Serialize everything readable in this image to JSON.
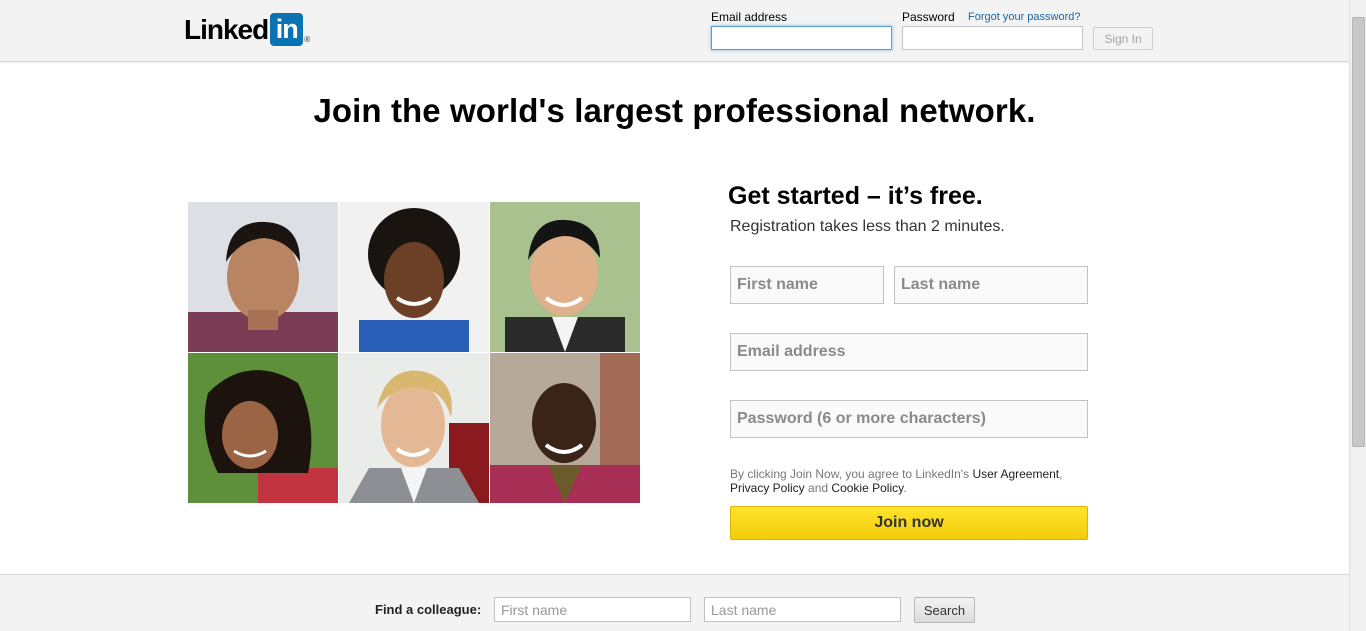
{
  "header": {
    "logo_text": "Linked",
    "logo_in": "in",
    "logo_reg": "®",
    "email_label": "Email address",
    "password_label": "Password",
    "forgot_link": "Forgot your password?",
    "signin_label": "Sign In"
  },
  "main": {
    "headline": "Join the world's largest professional network.",
    "reg_title": "Get started – it’s free.",
    "reg_subtitle": "Registration takes less than 2 minutes.",
    "first_name_placeholder": "First name",
    "last_name_placeholder": "Last name",
    "email_placeholder": "Email address",
    "password_placeholder": "Password (6 or more characters)",
    "terms_prefix": "By clicking Join Now, you agree to LinkedIn's",
    "terms_user_agreement": "User Agreement",
    "terms_comma": ",",
    "terms_privacy": "Privacy Policy",
    "terms_and": "and",
    "terms_cookie": "Cookie Policy",
    "terms_period": ".",
    "join_label": "Join now"
  },
  "footer": {
    "find_label": "Find a colleague:",
    "first_name_placeholder": "First name",
    "last_name_placeholder": "Last name",
    "search_label": "Search"
  },
  "colors": {
    "brand_blue": "#0b73b3",
    "join_yellow": "#f8d512",
    "link_blue": "#1a64a6"
  }
}
